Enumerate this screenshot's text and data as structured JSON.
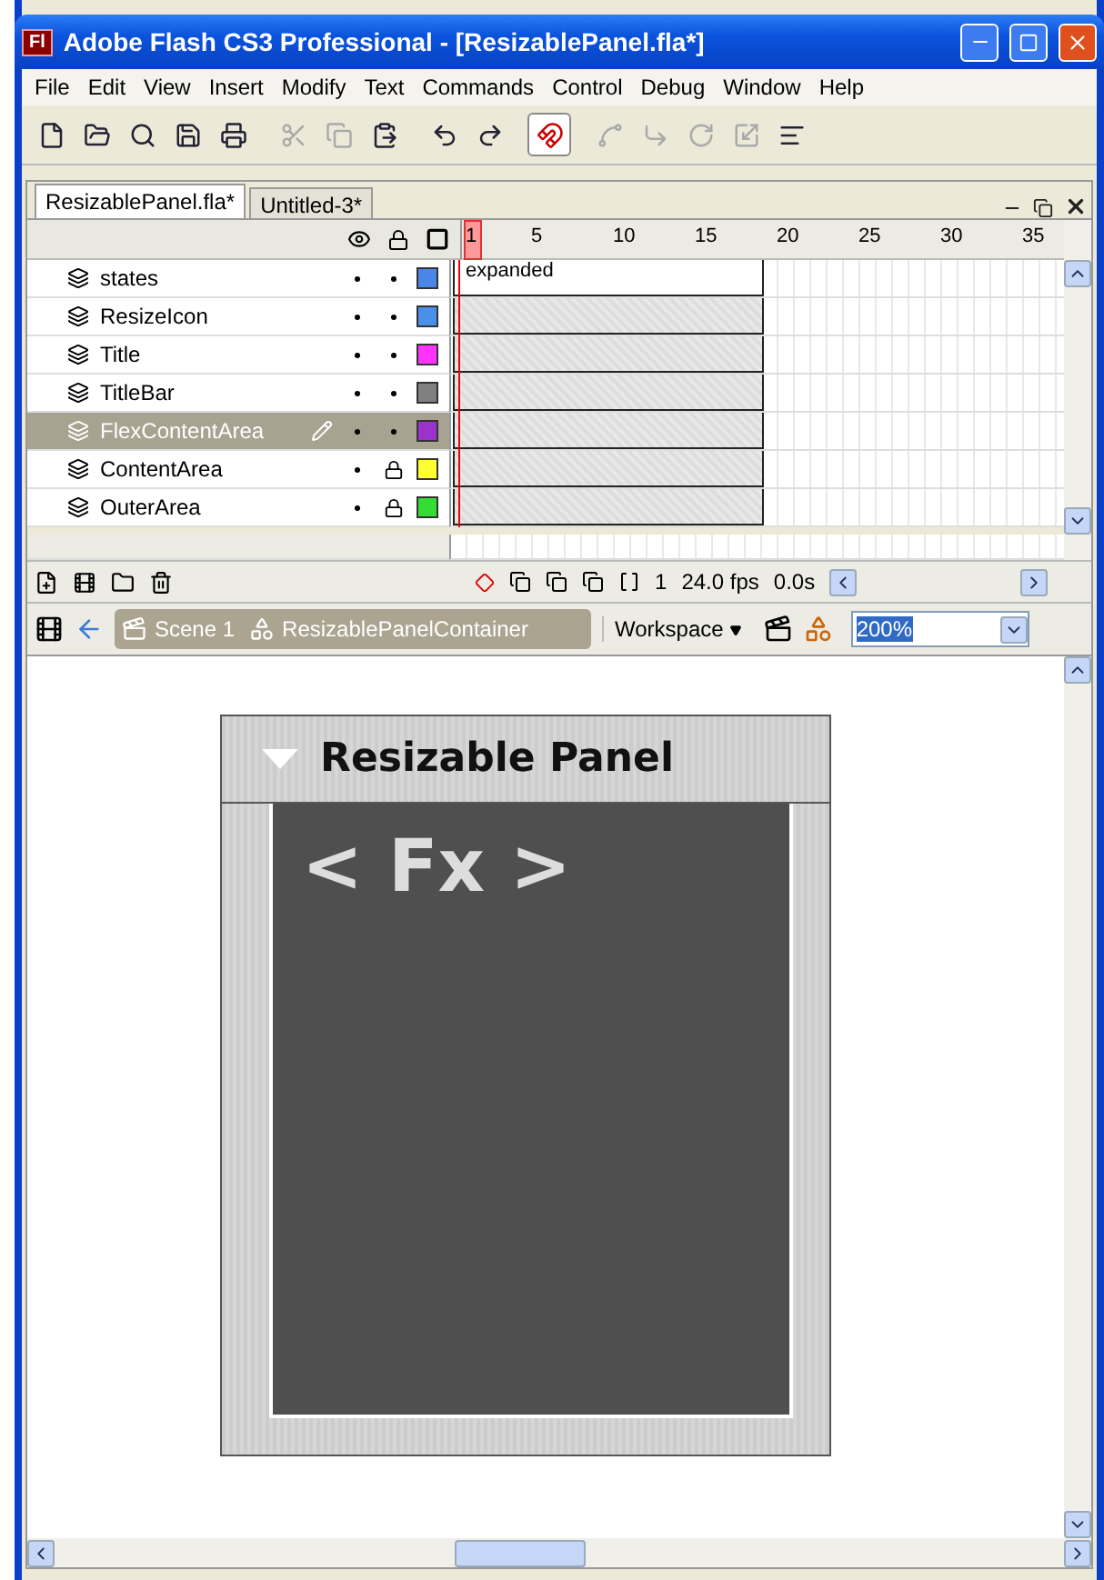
{
  "window": {
    "title": "Adobe Flash CS3 Professional - [ResizablePanel.fla*]",
    "app_badge": "Fl"
  },
  "menu": [
    "File",
    "Edit",
    "View",
    "Insert",
    "Modify",
    "Text",
    "Commands",
    "Control",
    "Debug",
    "Window",
    "Help"
  ],
  "toolbar": [
    {
      "kind": "new",
      "disabled": false,
      "on": false
    },
    {
      "kind": "open",
      "disabled": false,
      "on": false
    },
    {
      "kind": "find",
      "disabled": false,
      "on": false
    },
    {
      "kind": "save",
      "disabled": false,
      "on": false
    },
    {
      "kind": "print",
      "disabled": false,
      "on": false
    },
    {
      "kind": "cut",
      "disabled": true,
      "on": false
    },
    {
      "kind": "copy",
      "disabled": true,
      "on": false
    },
    {
      "kind": "paste",
      "disabled": false,
      "on": false
    },
    {
      "kind": "undo",
      "disabled": false,
      "on": false
    },
    {
      "kind": "redo",
      "disabled": false,
      "on": false
    },
    {
      "kind": "snap",
      "disabled": false,
      "on": true
    },
    {
      "kind": "smooth",
      "disabled": true,
      "on": false
    },
    {
      "kind": "straighten",
      "disabled": true,
      "on": false
    },
    {
      "kind": "rotate",
      "disabled": true,
      "on": false
    },
    {
      "kind": "scale",
      "disabled": true,
      "on": false
    },
    {
      "kind": "align",
      "disabled": false,
      "on": false
    }
  ],
  "document_tabs": [
    {
      "label": "ResizablePanel.fla*",
      "selected": true
    },
    {
      "label": "Untitled-3*",
      "selected": false
    }
  ],
  "timeline": {
    "frame_numbers": [
      "1",
      "5",
      "10",
      "15",
      "20",
      "25",
      "30",
      "35"
    ],
    "layers": [
      {
        "name": "states",
        "selected": false,
        "locked": false,
        "color": "#4a86e8",
        "label": "expanded"
      },
      {
        "name": "ResizeIcon",
        "selected": false,
        "locked": false,
        "color": "#4a90e8"
      },
      {
        "name": "Title",
        "selected": false,
        "locked": false,
        "color": "#ff33ff"
      },
      {
        "name": "TitleBar",
        "selected": false,
        "locked": false,
        "color": "#808080"
      },
      {
        "name": "FlexContentArea",
        "selected": true,
        "locked": false,
        "color": "#9933cc"
      },
      {
        "name": "ContentArea",
        "selected": false,
        "locked": true,
        "color": "#ffff33"
      },
      {
        "name": "OuterArea",
        "selected": false,
        "locked": true,
        "color": "#33dd33"
      }
    ],
    "current_frame": "1",
    "frame_rate": "24.0 fps",
    "elapsed": "0.0s"
  },
  "edit_bar": {
    "breadcrumbs": [
      {
        "kind": "scene",
        "label": "Scene 1"
      },
      {
        "kind": "symbol",
        "label": "ResizablePanelContainer"
      }
    ],
    "workspace": "Workspace",
    "zoom": "200%"
  },
  "stage": {
    "panel_title": "Resizable Panel",
    "logo": "< Fx >"
  }
}
